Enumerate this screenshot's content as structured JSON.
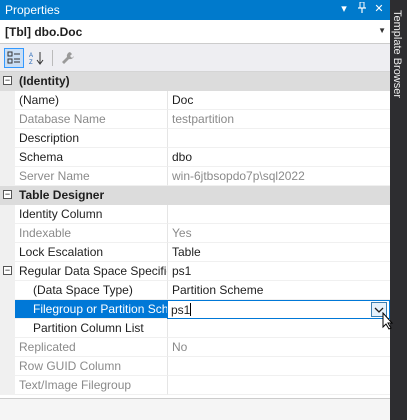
{
  "window": {
    "title": "Properties",
    "dropdown_glyph": "▾",
    "pin_glyph": "⊥",
    "close_glyph": "✕"
  },
  "object_selector": {
    "text": "[Tbl] dbo.Doc"
  },
  "sidebar": {
    "label": "Template Browser"
  },
  "categories": {
    "identity": "(Identity)",
    "table_designer": "Table Designer"
  },
  "properties": {
    "name": {
      "label": "(Name)",
      "value": "Doc"
    },
    "database_name": {
      "label": "Database Name",
      "value": "testpartition"
    },
    "description": {
      "label": "Description",
      "value": ""
    },
    "schema": {
      "label": "Schema",
      "value": "dbo"
    },
    "server_name": {
      "label": "Server Name",
      "value": "win-6jtbsopdo7p\\sql2022"
    },
    "identity_column": {
      "label": "Identity Column",
      "value": ""
    },
    "indexable": {
      "label": "Indexable",
      "value": "Yes"
    },
    "lock_escalation": {
      "label": "Lock Escalation",
      "value": "Table"
    },
    "regular_data_space": {
      "label": "Regular Data Space Specificati",
      "value": "ps1"
    },
    "data_space_type": {
      "label": "(Data Space Type)",
      "value": "Partition Scheme"
    },
    "filegroup_partition": {
      "label": "Filegroup or Partition Sch",
      "value": "ps1"
    },
    "partition_column_list": {
      "label": "Partition Column List",
      "value": ""
    },
    "replicated": {
      "label": "Replicated",
      "value": "No"
    },
    "row_guid_column": {
      "label": "Row GUID Column",
      "value": ""
    },
    "text_image_filegroup": {
      "label": "Text/Image Filegroup",
      "value": ""
    }
  },
  "colors": {
    "title_bar": "#007acc",
    "selection": "#0078d7",
    "category_bg": "#dcdcdc",
    "readonly_text": "#8a8a8a"
  }
}
